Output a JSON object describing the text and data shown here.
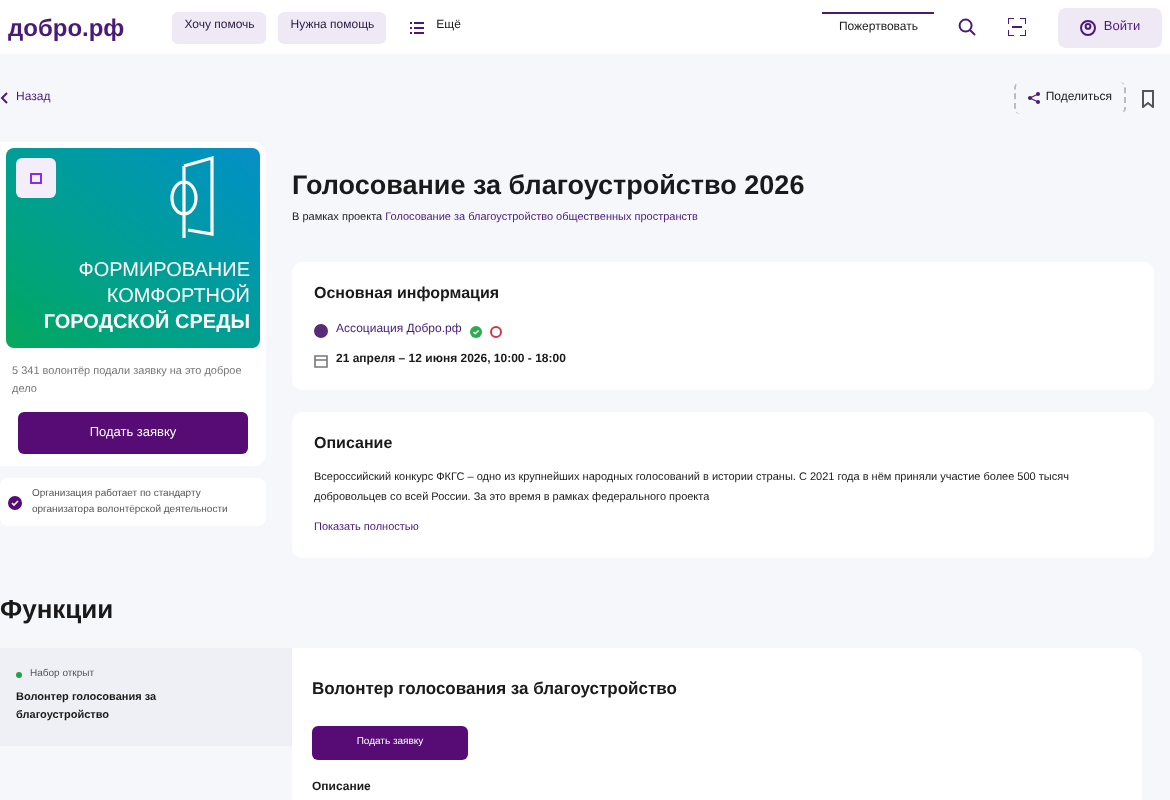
{
  "header": {
    "logo": "добро.рф",
    "nav": [
      {
        "label": "Хочу помочь",
        "kind": "pill"
      },
      {
        "label": "Нужна помощь",
        "kind": "pill"
      },
      {
        "label": "Ещё",
        "kind": "menu"
      }
    ],
    "donate": "Пожертвовать",
    "login": "Войти"
  },
  "back": "Назад",
  "share": "Поделиться",
  "banner": {
    "lines": [
      "ФОРМИРОВАНИЕ",
      "КОМФОРТНОЙ",
      "ГОРОДСКОЙ СРЕДЫ"
    ]
  },
  "volunteers_note": "5 341 волонтёр подали заявку на это доброе дело",
  "apply": "Подать заявку",
  "standard_note": "Организация работает по стандарту организатора волонтёрской деятельности",
  "title": "Голосование за благоустройство 2026",
  "subtitle": {
    "prefix": "В рамках проекта",
    "link": "Голосование за благоустройство общественных пространств"
  },
  "info": {
    "heading": "Основная информация",
    "organizer": "Ассоциация Добро.рф",
    "dates": "21 апреля – 12 июня 2026, 10:00 - 18:00"
  },
  "description": {
    "heading": "Описание",
    "text": "Всероссийский конкурс ФКГС – одно из крупнейших народных голосований в истории страны. С 2021 года в нём приняли участие более 500 тысяч добровольцев со всей России. За это время в рамках федерального проекта",
    "more": "Показать полностью"
  },
  "functions": {
    "heading": "Функции",
    "items": [
      {
        "status": "Набор открыт",
        "color": "#22a04b",
        "name": "Волонтер голосования за благоустройство",
        "selected": true
      }
    ],
    "detail": {
      "title": "Волонтер голосования за благоустройство",
      "apply": "Подать заявку",
      "section": "Описание"
    }
  }
}
